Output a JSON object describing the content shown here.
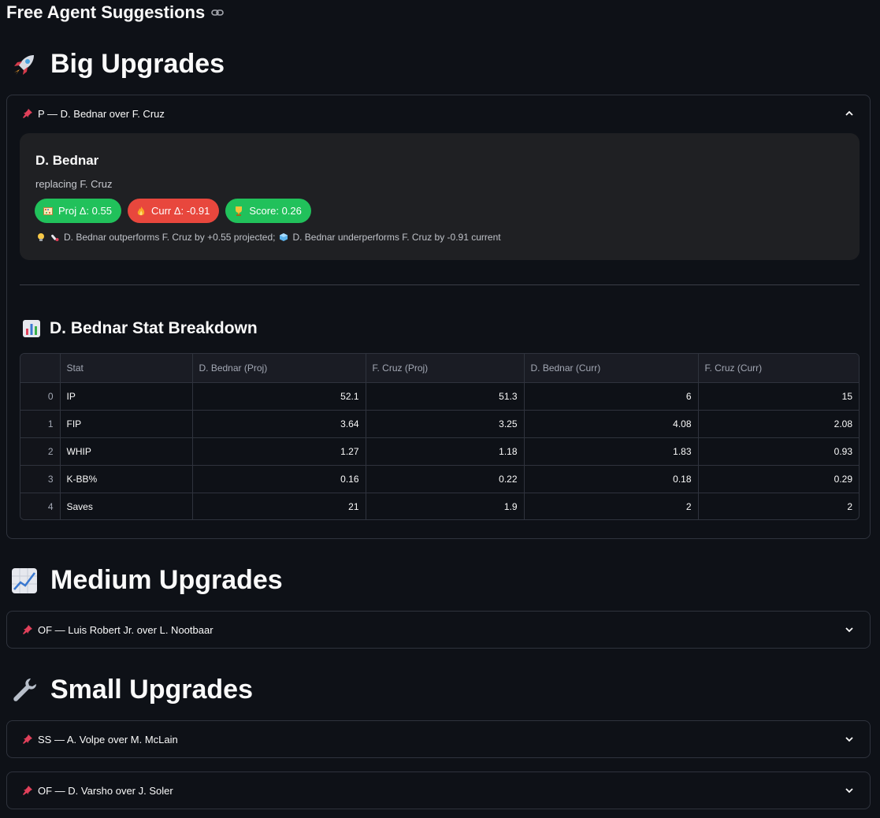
{
  "page": {
    "title": "Free Agent Suggestions",
    "link_icon": "link-icon"
  },
  "sections": {
    "big": {
      "emoji": "rocket-icon",
      "title": "Big Upgrades",
      "expander": {
        "label": "P — D. Bednar over F. Cruz",
        "expanded": true,
        "card": {
          "name": "D. Bednar",
          "replacing": "replacing F. Cruz",
          "badges": [
            {
              "icon": "abacus-icon",
              "label": "Proj Δ: 0.55",
              "color": "#21c15b"
            },
            {
              "icon": "fire-icon",
              "label": "Curr Δ: -0.91",
              "color": "#e8473d"
            },
            {
              "icon": "trophy-icon",
              "label": "Score: 0.26",
              "color": "#21c15b"
            }
          ],
          "insight": {
            "part1": "D. Bednar outperforms F. Cruz by +0.55 projected;",
            "part2": "D. Bednar underperforms F. Cruz by -0.91 current"
          }
        },
        "breakdown": {
          "title": "D. Bednar Stat Breakdown",
          "columns": [
            "",
            "Stat",
            "D. Bednar (Proj)",
            "F. Cruz (Proj)",
            "D. Bednar (Curr)",
            "F. Cruz (Curr)"
          ],
          "rows": [
            [
              "0",
              "IP",
              "52.1",
              "51.3",
              "6",
              "15"
            ],
            [
              "1",
              "FIP",
              "3.64",
              "3.25",
              "4.08",
              "2.08"
            ],
            [
              "2",
              "WHIP",
              "1.27",
              "1.18",
              "1.83",
              "0.93"
            ],
            [
              "3",
              "K-BB%",
              "0.16",
              "0.22",
              "0.18",
              "0.29"
            ],
            [
              "4",
              "Saves",
              "21",
              "1.9",
              "2",
              "2"
            ]
          ]
        }
      }
    },
    "medium": {
      "emoji": "chart-increasing-icon",
      "title": "Medium Upgrades",
      "expanders": [
        {
          "label": "OF — Luis Robert Jr. over L. Nootbaar",
          "expanded": false
        }
      ]
    },
    "small": {
      "emoji": "wrench-icon",
      "title": "Small Upgrades",
      "expanders": [
        {
          "label": "SS — A. Volpe over M. McLain",
          "expanded": false
        },
        {
          "label": "OF — D. Varsho over J. Soler",
          "expanded": false
        }
      ]
    }
  }
}
